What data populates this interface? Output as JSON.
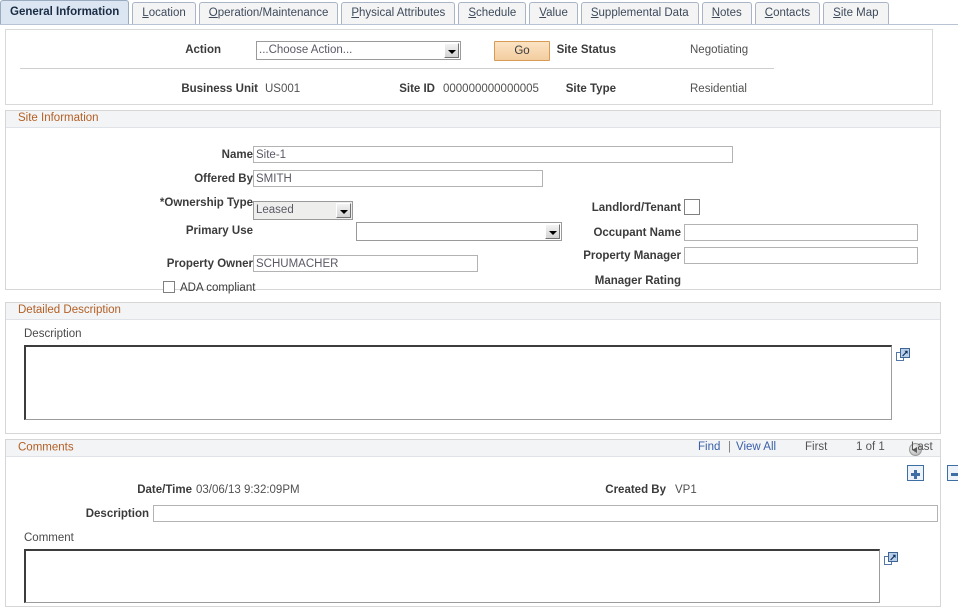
{
  "tabs": [
    {
      "label": "General Information",
      "accel": "",
      "active": true
    },
    {
      "label": "Location",
      "accel": "L",
      "active": false
    },
    {
      "label": "Operation/Maintenance",
      "accel": "O",
      "active": false
    },
    {
      "label": "Physical Attributes",
      "accel": "P",
      "active": false
    },
    {
      "label": "Schedule",
      "accel": "S",
      "active": false
    },
    {
      "label": "Value",
      "accel": "V",
      "active": false
    },
    {
      "label": "Supplemental Data",
      "accel": "S",
      "active": false
    },
    {
      "label": "Notes",
      "accel": "N",
      "active": false
    },
    {
      "label": "Contacts",
      "accel": "C",
      "active": false
    },
    {
      "label": "Site Map",
      "accel": "S",
      "active": false
    }
  ],
  "header": {
    "action_label": "Action",
    "action_value": "...Choose Action...",
    "go_label": "Go",
    "site_status_label": "Site Status",
    "site_status_value": "Negotiating",
    "business_unit_label": "Business Unit",
    "business_unit_value": "US001",
    "site_id_label": "Site ID",
    "site_id_value": "000000000000005",
    "site_type_label": "Site Type",
    "site_type_value": "Residential"
  },
  "site_information": {
    "title": "Site Information",
    "name_label": "Name",
    "name_value": "Site-1",
    "offered_by_label": "Offered By",
    "offered_by_value": "SMITH",
    "ownership_type_label": "*Ownership Type",
    "ownership_type_value": "Leased",
    "primary_use_label": "Primary Use",
    "primary_use_value": "",
    "property_owner_label": "Property Owner",
    "property_owner_value": "SCHUMACHER",
    "ada_compliant_label": "ADA compliant",
    "ada_compliant_checked": false,
    "landlord_tenant_label": "Landlord/Tenant",
    "landlord_tenant_checked": false,
    "occupant_name_label": "Occupant Name",
    "occupant_name_value": "",
    "property_manager_label": "Property Manager",
    "property_manager_value": "",
    "manager_rating_label": "Manager Rating",
    "manager_rating_value": ""
  },
  "detailed_description": {
    "title": "Detailed Description",
    "description_label": "Description",
    "description_value": "",
    "expand_icon": "expand-popup-icon"
  },
  "comments": {
    "title": "Comments",
    "find_label": "Find",
    "separator": "|",
    "view_all_label": "View All",
    "first_label": "First",
    "counter_label": "1 of 1",
    "last_label": "Last",
    "prev_icon": "previous-arrow-icon",
    "next_icon": "next-arrow-icon",
    "add_row_icon": "add-row-icon",
    "delete_row_icon": "delete-row-icon",
    "date_time_label": "Date/Time",
    "date_time_value": "03/06/13  9:32:09PM",
    "created_by_label": "Created By",
    "created_by_value": "VP1",
    "description_label": "Description",
    "description_value": "",
    "comment_label": "Comment",
    "comment_value": "",
    "expand_icon": "expand-popup-icon"
  },
  "colors": {
    "active_tab_bg": "#dce6f2",
    "section_header_text": "#b45f23",
    "link": "#3a5fa8",
    "go_button": "#f3cda0"
  }
}
